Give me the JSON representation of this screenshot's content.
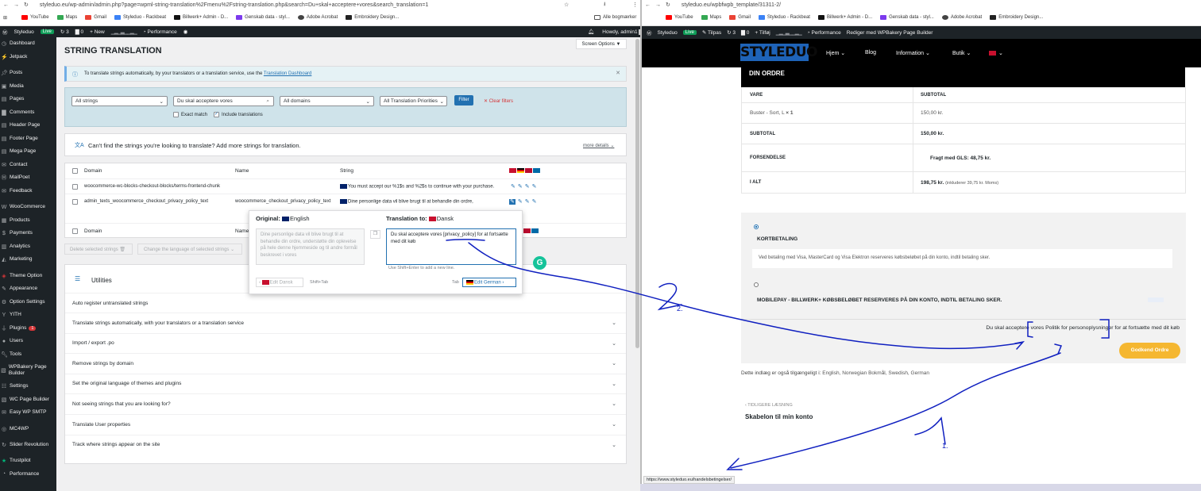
{
  "left_window": {
    "url": "styleduo.eu/wp-admin/admin.php?page=wpml-string-translation%2Fmenu%2Fstring-translation.php&search=Du+skal+acceptere+vores&search_translation=1",
    "bookmarks": [
      "YouTube",
      "Maps",
      "Gmail",
      "Styleduo - Rackbeat",
      "Billwerk+ Admin - D...",
      "Genskab data - styl...",
      "Adobe Acrobat",
      "Embroidery Design..."
    ],
    "bookmarks_right": "Alle bogmærker",
    "adminbar": {
      "site": "Styleduo",
      "live": "Live",
      "updates": "3",
      "comments": "0",
      "new": "+ New",
      "performance": "Performance",
      "howdy": "Howdy, admin1"
    },
    "sidebar": [
      {
        "label": "Dashboard",
        "icon": "dashboard-icon"
      },
      {
        "label": "Jetpack",
        "icon": "jetpack-icon"
      },
      {
        "label": "Posts",
        "icon": "pin-icon"
      },
      {
        "label": "Media",
        "icon": "media-icon"
      },
      {
        "label": "Pages",
        "icon": "page-icon"
      },
      {
        "label": "Comments",
        "icon": "comment-icon"
      },
      {
        "label": "Header Page",
        "icon": "page-icon"
      },
      {
        "label": "Footer Page",
        "icon": "page-icon"
      },
      {
        "label": "Mega Page",
        "icon": "page-icon"
      },
      {
        "label": "Contact",
        "icon": "mail-icon"
      },
      {
        "label": "MailPoet",
        "icon": "mailpoet-icon"
      },
      {
        "label": "Feedback",
        "icon": "feedback-icon"
      },
      {
        "label": "WooCommerce",
        "icon": "woo-icon"
      },
      {
        "label": "Products",
        "icon": "box-icon"
      },
      {
        "label": "Payments",
        "icon": "payment-icon"
      },
      {
        "label": "Analytics",
        "icon": "chart-icon"
      },
      {
        "label": "Marketing",
        "icon": "megaphone-icon"
      },
      {
        "label": "Theme Option",
        "icon": "theme-icon"
      },
      {
        "label": "Appearance",
        "icon": "brush-icon"
      },
      {
        "label": "Option Settings",
        "icon": "gear-icon"
      },
      {
        "label": "YITH",
        "icon": "yith-icon"
      },
      {
        "label": "Plugins",
        "icon": "plug-icon",
        "badge": "1"
      },
      {
        "label": "Users",
        "icon": "user-icon"
      },
      {
        "label": "Tools",
        "icon": "wrench-icon"
      },
      {
        "label": "WPBakery Page Builder",
        "icon": "builder-icon"
      },
      {
        "label": "Settings",
        "icon": "settings-icon"
      },
      {
        "label": "WC Page Builder",
        "icon": "builder-icon"
      },
      {
        "label": "Easy WP SMTP",
        "icon": "smtp-icon"
      },
      {
        "label": "MC4WP",
        "icon": "mc4wp-icon"
      },
      {
        "label": "Slider Revolution",
        "icon": "slider-icon"
      },
      {
        "label": "Trustpilot",
        "icon": "star-icon"
      },
      {
        "label": "Performance",
        "icon": "performance-icon"
      }
    ],
    "page_title": "STRING TRANSLATION",
    "screen_options": "Screen Options ▼",
    "notice": {
      "text": "To translate strings automatically, by your translators or a translation service, use the",
      "link": "Translation Dashboard"
    },
    "filters": {
      "strings": "All strings",
      "search": "Du skal acceptere vores",
      "domains": "All domains",
      "priorities": "All Translation Priorities",
      "filter_btn": "Filter",
      "clear": "Clear filters",
      "exact": "Exact match",
      "include": "Include translations"
    },
    "cant_find": {
      "text": "Can't find the strings you're looking to translate? Add more strings for translation.",
      "more": "more details"
    },
    "table": {
      "headers": [
        "Domain",
        "Name",
        "String"
      ],
      "rows": [
        {
          "domain": "woocommerce-wc-blocks-checkout-blocks/terms-frontend-chunk",
          "name": "",
          "string": "You must accept our %1$s and %2$s to continue with your purchase."
        },
        {
          "domain": "admin_texts_woocommerce_checkout_privacy_policy_text",
          "name": "woocommerce_checkout_privacy_policy_text",
          "string": "Dine personlige data vil blive brugt til at behandle din ordre,"
        }
      ],
      "footer": [
        "Domain",
        "Name"
      ]
    },
    "bulk": {
      "delete": "Delete selected strings",
      "change_lang": "Change the language of selected strings"
    },
    "popup": {
      "original_label": "Original:",
      "original_lang": "English",
      "translation_label": "Translation to:",
      "translation_lang": "Dansk",
      "original_text": "Dine personlige data vil blive brugt til at behandle din ordre, understøtte din oplevelse på hele denne hjemmeside og til andre formål beskrevet i vores",
      "translation_text": "Du skal acceptere vores [privacy_policy] for at fortsætte med dit køb",
      "hint": "Use Shift+Enter to add a new line.",
      "edit_dansk": "Edit Dansk",
      "shift_tab": "Shift+Tab",
      "tab": "Tab",
      "edit_german": "Edit German"
    },
    "utilities": {
      "title": "Utilities",
      "auto_register": "Auto register untranslated strings",
      "items": [
        "Translate strings automatically, with your translators or a translation service",
        "Import / export .po",
        "Remove strings by domain",
        "Set the original language of themes and plugins",
        "Not seeing strings that you are looking for?",
        "Translate User properties",
        "Track where strings appear on the site"
      ]
    }
  },
  "right_window": {
    "url": "styleduo.eu/wpbfwpb_template/31311-2/",
    "bookmarks": [
      "YouTube",
      "Maps",
      "Gmail",
      "Styleduo - Rackbeat",
      "Billwerk+ Admin - D...",
      "Genskab data - styl...",
      "Adobe Acrobat",
      "Embroidery Design..."
    ],
    "sitebar": {
      "site": "Styleduo",
      "live": "Live",
      "customize": "Tilpas",
      "updates": "3",
      "comments": "0",
      "add": "+ Tilføj",
      "performance": "Performance",
      "edit": "Rediger med WPBakery Page Builder"
    },
    "logo": "STYLEDUO",
    "nav": [
      "Hjem",
      "Blog",
      "Information",
      "Butik"
    ],
    "order": {
      "title": "DIN ORDRE",
      "col_product": "VARE",
      "col_subtotal": "SUBTOTAL",
      "item": "Buster - Sort, L",
      "qty": "× 1",
      "item_price": "150,00 kr.",
      "subtotal_label": "SUBTOTAL",
      "subtotal": "150,00 kr.",
      "shipping_label": "FORSENDELSE",
      "shipping": "Fragt med GLS: 48,75 kr.",
      "total_label": "I ALT",
      "total": "198,75 kr.",
      "vat": "(inkluderer 39,75 kr. Moms)"
    },
    "payment": {
      "card_label": "KORTBETALING",
      "card_desc": "Ved betaling med Visa, MasterCard og Visa Elektron reserveres købsbeløbet på din konto, indtil betaling sker.",
      "mobilepay_label": "MOBILEPAY - BILLWERK+ KØBSBELØBET RESERVERES PÅ DIN KONTO, INDTIL BETALING SKER.",
      "terms_prefix": "Du skal acceptere vores",
      "terms_link": "Politik for personoplysninger",
      "terms_suffix": "for at fortsætte med dit køb",
      "order_btn": "Godkend Ordre"
    },
    "languages": {
      "text": "Dette indlæg er også tilgængeligt i:",
      "list": "English, Norwegian Bokmål, Swedish, German"
    },
    "prev": {
      "label": "‹ TIDLIGERE LÆSNING",
      "title": "Skabelon til min konto"
    },
    "status_url": "https://www.styleduo.eu/handelsbetingelser/"
  },
  "annotations": {
    "mark_1": "1.",
    "mark_2": "2."
  },
  "colors": {
    "wp_dark": "#1d2327",
    "wp_blue": "#2271b1",
    "annotation": "#1020c0",
    "order_btn": "#f5b731"
  }
}
